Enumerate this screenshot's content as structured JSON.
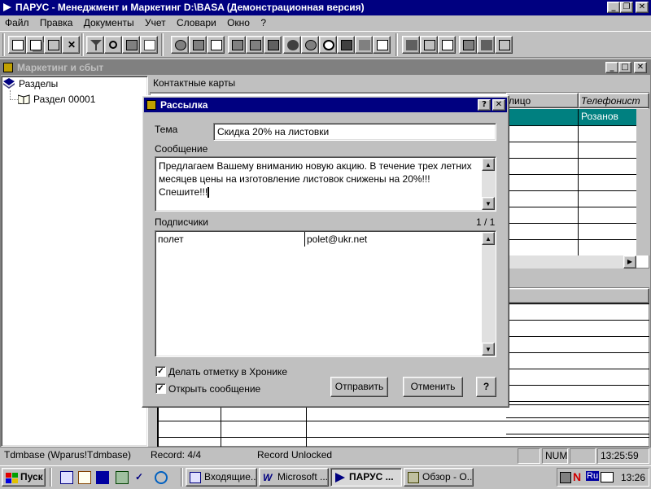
{
  "app": {
    "title": "ПАРУС - Менеджмент и Маркетинг  D:\\BASA (Демонстрационная версия)",
    "menu": [
      "Файл",
      "Правка",
      "Документы",
      "Учет",
      "Словари",
      "Окно",
      "?"
    ]
  },
  "child_window": {
    "title": "Маркетинг и сбыт",
    "tree": {
      "root": "Разделы",
      "child": "Раздел 00001"
    },
    "tab_label": "Контактные карты",
    "grid": {
      "col_face": "лицо",
      "col_phone": "Телефонист",
      "row1_value": "Розанов"
    }
  },
  "dialog": {
    "title": "Рассылка",
    "help_btn": "?",
    "close_btn": "✕",
    "subject_label": "Тема",
    "subject_value": "Скидка 20% на листовки",
    "message_label": "Сообщение",
    "message_value": "Предлагаем Вашему вниманию новую акцию. В течение трех летних месяцев цены на изготовление листовок снижены на 20%!!! Спешите!!!",
    "subscribers_label": "Подписчики",
    "subscribers_count": "1 / 1",
    "subscribers": [
      {
        "name": "полет",
        "email": "polet@ukr.net"
      }
    ],
    "chk_chronicle_label": "Делать отметку в Хронике",
    "chk_chronicle_checked": true,
    "chk_open_label": "Открыть сообщение",
    "chk_open_checked": true,
    "send_label": "Отправить",
    "cancel_label": "Отменить",
    "help_label": "?"
  },
  "statusbar": {
    "db": "Tdmbase (Wparus!Tdmbase)",
    "record": "Record: 4/4",
    "lock": "Record Unlocked",
    "num": "NUM",
    "time": "13:25:59"
  },
  "taskbar": {
    "start": "Пуск",
    "tasks": [
      "Входящие...",
      "Microsoft ...",
      "ПАРУС ...",
      "Обзор - О..."
    ],
    "clock": "13:26",
    "lang": "Ru"
  }
}
